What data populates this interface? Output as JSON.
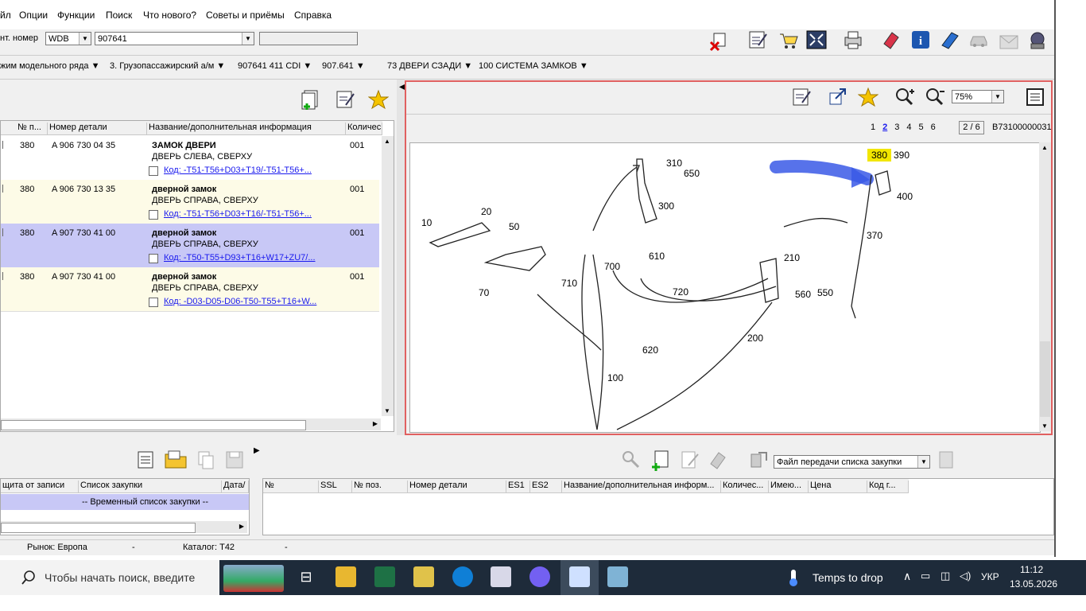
{
  "menu": {
    "file": "йл",
    "options": "Опции",
    "functions": "Функции",
    "search": "Поиск",
    "whatsnew": "Что нового?",
    "tips": "Советы и приёмы",
    "help": "Справка"
  },
  "ident": {
    "label": "нт. номер",
    "prefix": "WDB",
    "number": "907641",
    "extra": ""
  },
  "breadcrumb": [
    "жим модельного ряда",
    "3. Грузопассажирский а/м",
    "907641 411 CDI",
    "907.641",
    "73 ДВЕРИ СЗАДИ",
    "100 СИСТЕМА ЗАМКОВ"
  ],
  "parts_table": {
    "columns": [
      "№ п...",
      "Номер детали",
      "Название/дополнительная информация",
      "Количес"
    ],
    "rows": [
      {
        "pos": "380",
        "part": "A 906 730 04 35",
        "name": "ЗАМОК ДВЕРИ",
        "info": "ДВЕРЬ СЛЕВА, СВЕРХУ",
        "code": "Код: -T51-T56+D03+T19/-T51-T56+...",
        "qty": "001"
      },
      {
        "pos": "380",
        "part": "A 906 730 13 35",
        "name": "дверной замок",
        "info": "ДВЕРЬ СПРАВА, СВЕРХУ",
        "code": "Код: -T51-T56+D03+T16/-T51-T56+...",
        "qty": "001"
      },
      {
        "pos": "380",
        "part": "A 907 730 41 00",
        "name": "дверной замок",
        "info": "ДВЕРЬ СПРАВА, СВЕРХУ",
        "code": "Код: -T50-T55+D93+T16+W17+ZU7/...",
        "qty": "001"
      },
      {
        "pos": "380",
        "part": "A 907 730 41 00",
        "name": "дверной замок",
        "info": "ДВЕРЬ СПРАВА, СВЕРХУ",
        "code": "Код: -D03-D05-D06-T50-T55+T16+W...",
        "qty": "001"
      }
    ]
  },
  "viewer": {
    "zoom": "75%",
    "pages": [
      "1",
      "2",
      "3",
      "4",
      "5",
      "6"
    ],
    "current_page": "2",
    "page_counter": "2 / 6",
    "image_code": "B73100000031",
    "labels": [
      "380",
      "390",
      "310",
      "650",
      "10",
      "20",
      "50",
      "300",
      "400",
      "370",
      "610",
      "700",
      "710",
      "210",
      "720",
      "560",
      "550",
      "70",
      "620",
      "200",
      "100"
    ]
  },
  "shopping": {
    "columns": [
      "щита от записи",
      "Список закупки",
      "Дата/"
    ],
    "row": "-- Временный список закупки --"
  },
  "cart": {
    "transfer_file": "Файл передачи списка закупки",
    "columns": [
      "№",
      "SSL",
      "№ поз.",
      "Номер детали",
      "ES1",
      "ES2",
      "Название/дополнительная информ...",
      "Количес...",
      "Имею...",
      "Цена",
      "Код г..."
    ]
  },
  "status": {
    "market": "Рынок: Европа",
    "dash1": "-",
    "catalog": "Каталог: T42",
    "dash2": "-"
  },
  "taskbar": {
    "search": "Чтобы начать поиск, введите",
    "weather": "Temps to drop",
    "lang": "УКР",
    "time": "11:12",
    "date": "13.05.2026"
  },
  "colors": {
    "highlight_row": "#c8c8f6",
    "yellow_row": "#fdfbe7",
    "accent": "#316ac5",
    "viewer_border": "#e06060"
  }
}
